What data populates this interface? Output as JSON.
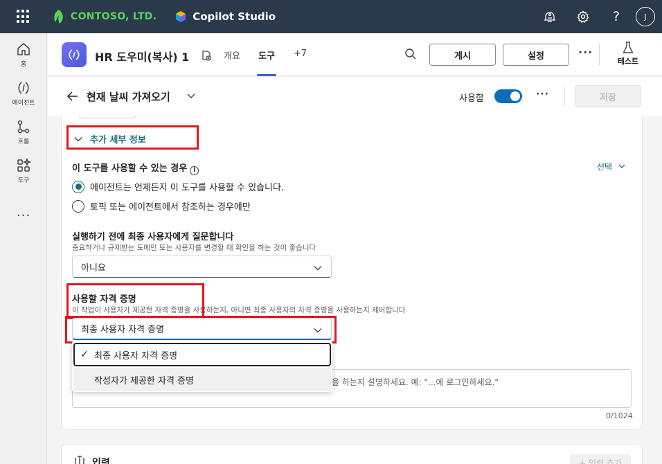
{
  "topbar": {
    "company": "CONTOSO, LTD.",
    "product": "Copilot Studio",
    "avatar_initial": "J",
    "icons": [
      "waffle-icon",
      "copilot-hub-icon",
      "settings-icon",
      "help-icon"
    ]
  },
  "rail": {
    "items": [
      {
        "label": "홈",
        "icon": "home-icon"
      },
      {
        "label": "에이전트",
        "icon": "agents-icon"
      },
      {
        "label": "흐름",
        "icon": "flow-icon"
      },
      {
        "label": "도구",
        "icon": "tools-icon"
      }
    ],
    "more": "..."
  },
  "header": {
    "agent_name": "HR 도우미(복사) 1",
    "tabs": [
      {
        "label": "개요",
        "active": false
      },
      {
        "label": "도구",
        "active": true
      },
      {
        "label": "+7",
        "active": false
      }
    ],
    "publish_label": "게시",
    "settings_label": "설정",
    "more": "···",
    "test_label": "테스트"
  },
  "subheader": {
    "title": "현재 날씨 가져오기",
    "enabled_label": "사용함",
    "enabled": true,
    "more": "···",
    "save_label": "저장"
  },
  "details": {
    "section_toggle": "추가 세부 정보",
    "usage": {
      "label": "이 도구를 사용할 수 있는 경우",
      "select_label": "선택",
      "options": [
        {
          "label": "에이전트는 언제든지 이 도구를 사용할 수 있습니다.",
          "checked": true
        },
        {
          "label": "토픽 또는 에이전트에서 참조하는 경우에만",
          "checked": false
        }
      ]
    },
    "ask_user": {
      "label": "실행하기 전에 최종 사용자에게 질문합니다",
      "help": "중요하거나 규제받는 도메인 또는 사용자를 변경할 때 확인을 하는 것이 좋습니다",
      "value": "아니요"
    },
    "credentials": {
      "label": "사용할 자격 증명",
      "help": "이 작업이 사용자가 제공한 자격 증명을 사용하는지, 아니면 최종 사용자의 자격 증명을 사용하는지 제어합니다.",
      "value": "최종 사용자 자격 증명",
      "options": [
        {
          "label": "최종 사용자 자격 증명",
          "selected": true
        },
        {
          "label": "작성자가 제공한 자격 증명",
          "selected": false
        }
      ]
    },
    "description_placeholder": "을 하는지 설명하세요. 예: \"...에 로그인하세요.\"",
    "counter": "0/1024"
  },
  "inputs_card": {
    "title": "입력",
    "add_label": "+ 입력 추가"
  },
  "colors": {
    "topbar": "#2b3a4a",
    "accent": "#0f6cbd",
    "link": "#1a6e80",
    "highlight": "#e0181e"
  }
}
